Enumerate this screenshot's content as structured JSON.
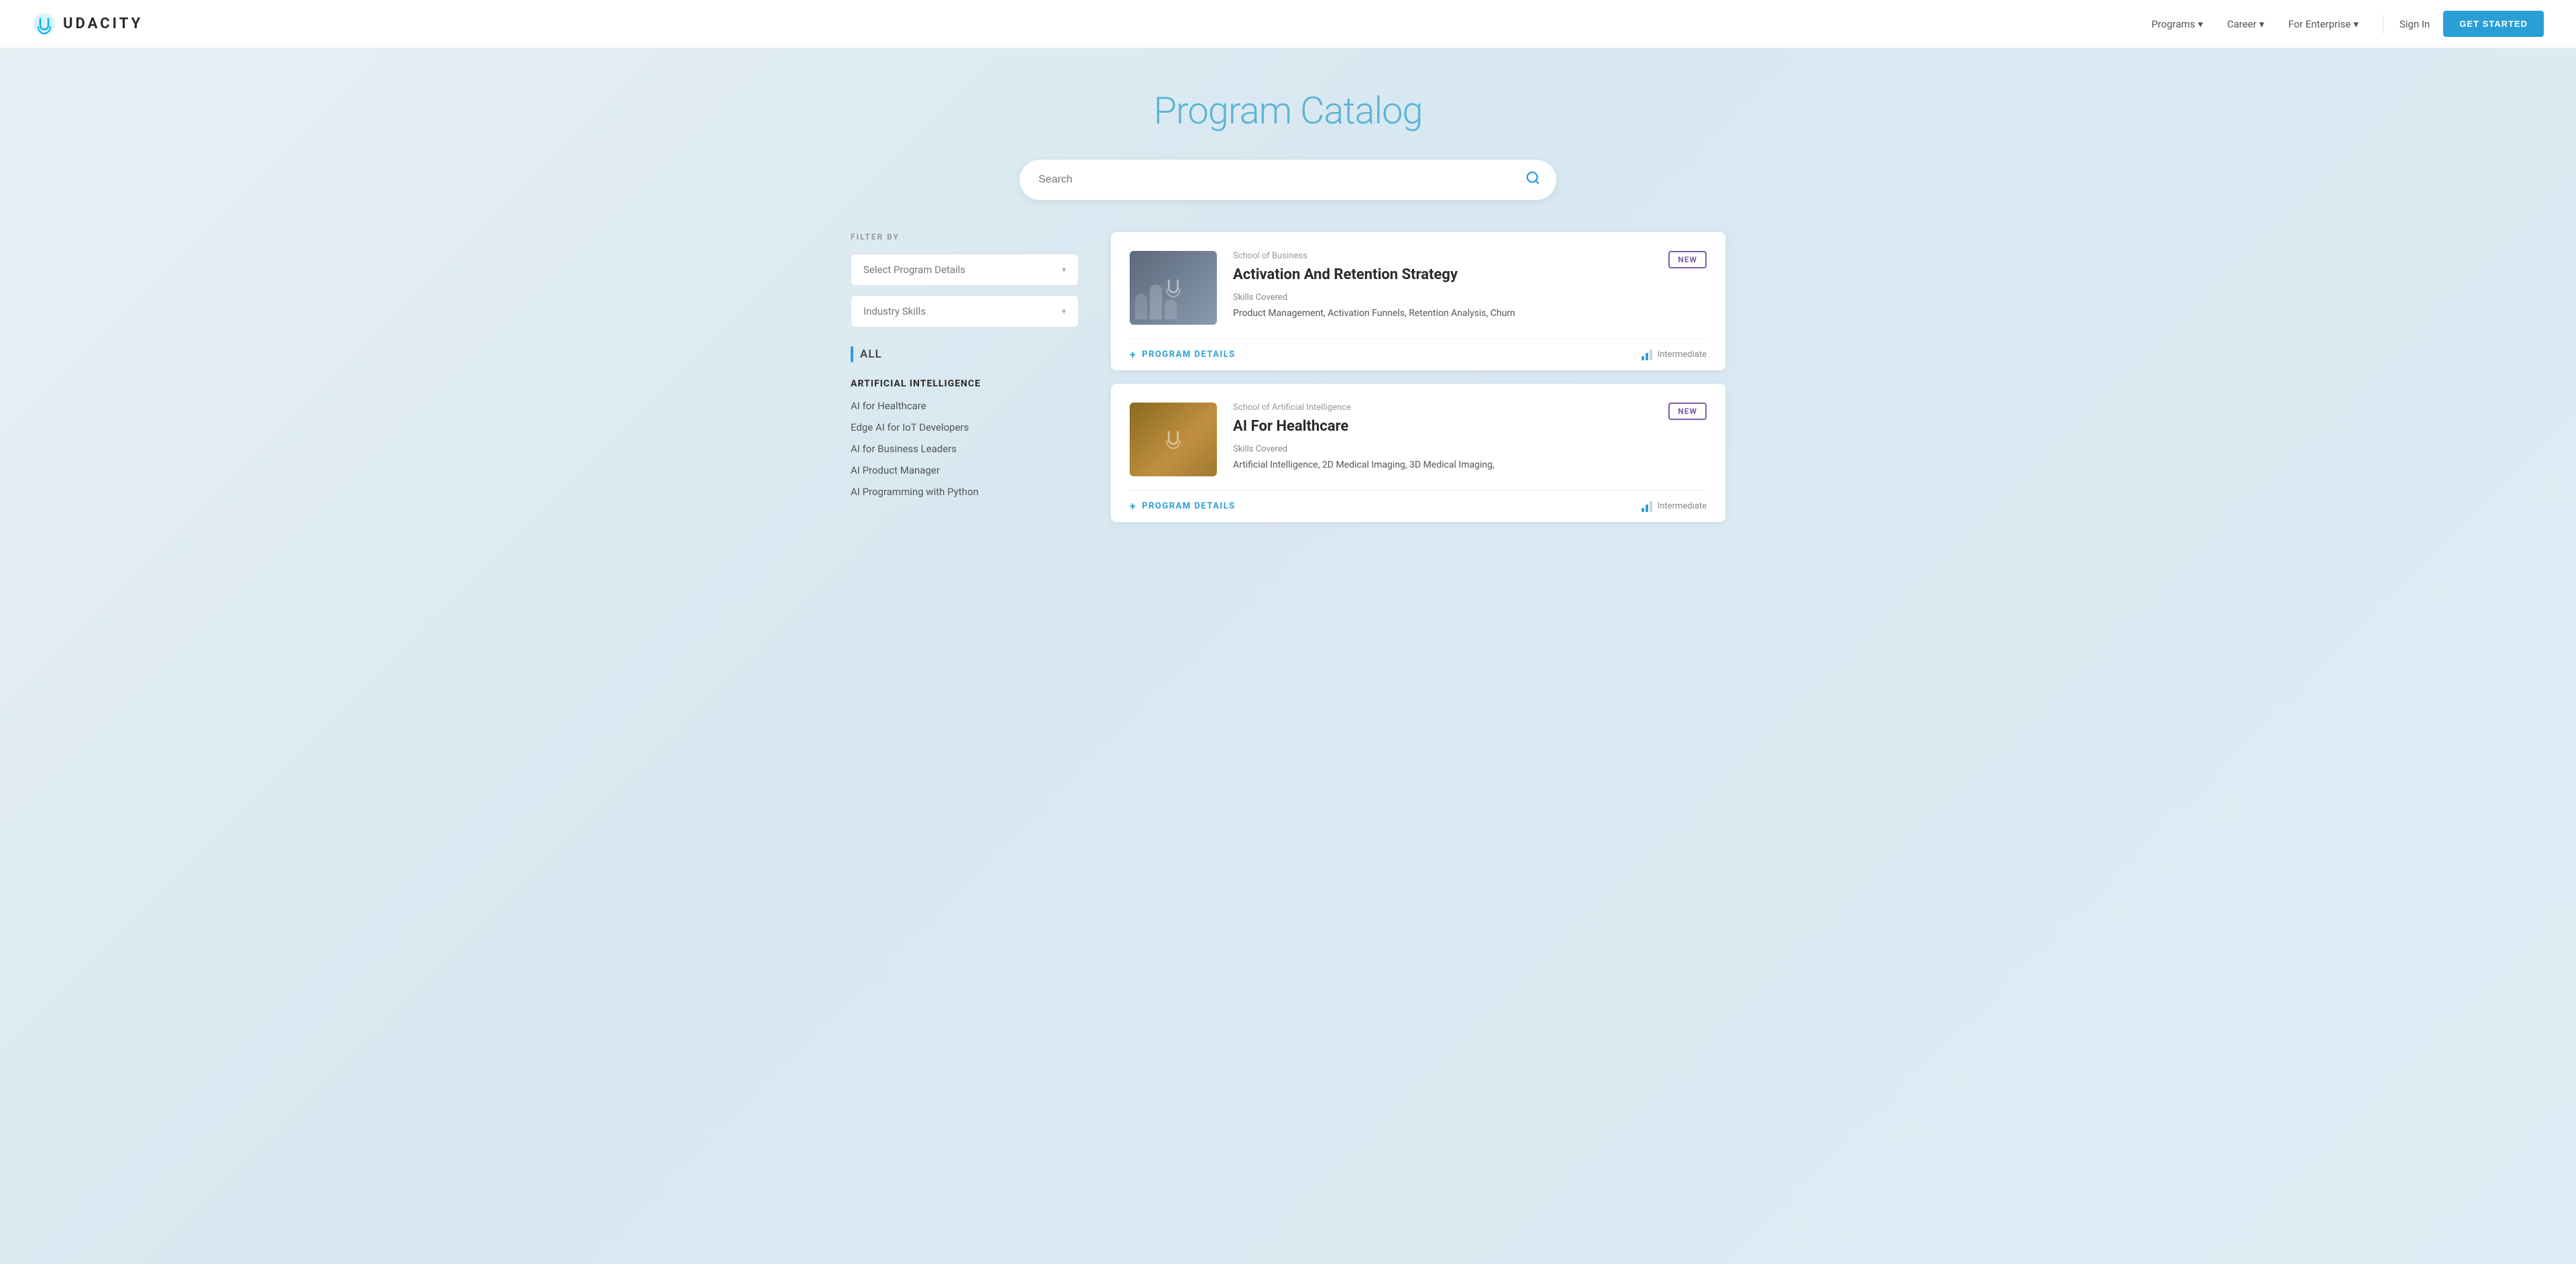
{
  "navbar": {
    "logo_text": "UDACITY",
    "nav_items": [
      {
        "label": "Programs",
        "has_dropdown": true
      },
      {
        "label": "Career",
        "has_dropdown": true
      },
      {
        "label": "For Enterprise",
        "has_dropdown": true
      }
    ],
    "sign_in": "Sign In",
    "get_started": "GET STARTED"
  },
  "hero": {
    "page_title": "Program Catalog"
  },
  "search": {
    "placeholder": "Search"
  },
  "sidebar": {
    "filter_label": "FILTER BY",
    "dropdown1": "Select Program Details",
    "dropdown2": "Industry Skills",
    "all_label": "ALL",
    "categories": [
      {
        "title": "ARTIFICIAL INTELLIGENCE",
        "items": [
          "AI for Healthcare",
          "Edge AI for IoT Developers",
          "AI for Business Leaders",
          "AI Product Manager",
          "AI Programming with Python"
        ]
      }
    ]
  },
  "programs": [
    {
      "school": "School of Business",
      "title": "Activation And Retention Strategy",
      "is_new": true,
      "new_label": "NEW",
      "skills_label": "Skills Covered",
      "skills": "Product Management, Activation Funnels, Retention Analysis, Churn",
      "details_label": "PROGRAM DETAILS",
      "difficulty": "Intermediate",
      "thumb_type": "business"
    },
    {
      "school": "School of Artificial Intelligence",
      "title": "AI For Healthcare",
      "is_new": true,
      "new_label": "NEW",
      "skills_label": "Skills Covered",
      "skills": "Artificial Intelligence, 2D Medical Imaging, 3D Medical Imaging,",
      "details_label": "PROGRAM DETAILS",
      "difficulty": "Intermediate",
      "thumb_type": "ai"
    }
  ]
}
